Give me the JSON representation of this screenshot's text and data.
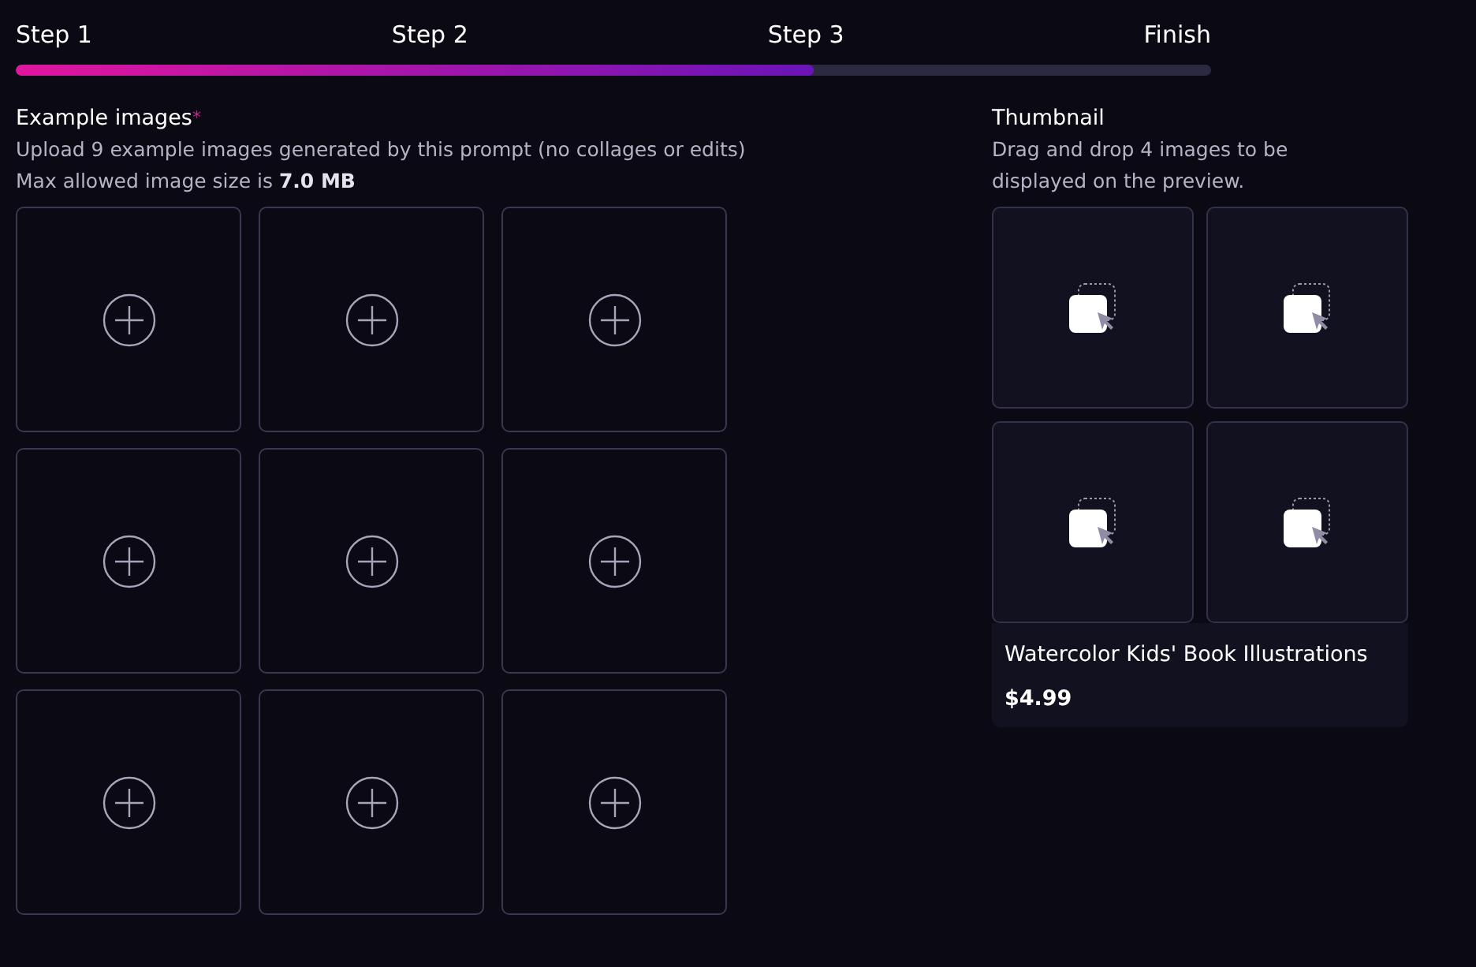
{
  "steps": [
    {
      "label": "Step 1"
    },
    {
      "label": "Step 2"
    },
    {
      "label": "Step 3"
    },
    {
      "label": "Finish"
    }
  ],
  "progress": {
    "level": 0.667
  },
  "examples": {
    "title": "Example images",
    "required_mark": "*",
    "description": "Upload 9 example images generated by this prompt (no collages or edits)",
    "limit": "Max allowed image size is **7.0 MB**"
  },
  "thumbnail": {
    "title": "Thumbnail",
    "description": "Drag and drop 4 images to be displayed on the preview.",
    "name": "Watercolor Kids' Book Illustrations",
    "price": "$4.99"
  }
}
